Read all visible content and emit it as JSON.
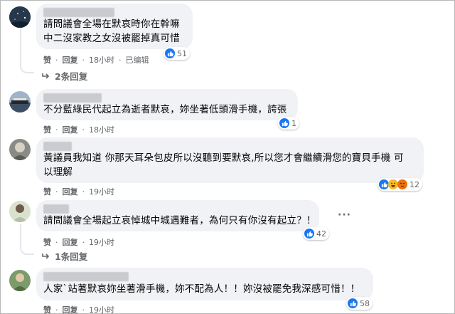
{
  "comments": [
    {
      "lines": [
        "請問議會全場在默哀時你在幹嘛",
        "中二沒家教之女沒被罷掉真可惜"
      ],
      "meta": {
        "like": "赞",
        "reply": "回复",
        "time": "18小时",
        "edited": "已编辑"
      },
      "reactions": {
        "count": "51",
        "icons": [
          "like-icon"
        ]
      },
      "replies_label": "2条回复"
    },
    {
      "lines": [
        "不分藍綠民代起立為逝者默哀，妳坐著低頭滑手機，誇張"
      ],
      "meta": {
        "like": "赞",
        "reply": "回复",
        "time": "18小时"
      },
      "reactions": {
        "count": "1",
        "icons": [
          "like-icon"
        ]
      }
    },
    {
      "lines": [
        "黃議員我知道 你那天耳朵包皮所以沒聽到要默哀,所以您才會繼續滑您的寶貝手機 可",
        "以理解"
      ],
      "meta": {
        "like": "赞",
        "reply": "回复",
        "time": "19小时"
      },
      "reactions": {
        "count": "12",
        "icons": [
          "like-icon",
          "haha-icon",
          "angry-icon"
        ]
      }
    },
    {
      "lines": [
        "請問議會全場起立哀悼城中城遇難者，為何只有你沒有起立？！"
      ],
      "meta": {
        "like": "赞",
        "reply": "回复",
        "time": "19小时"
      },
      "reactions": {
        "count": "42",
        "icons": [
          "like-icon"
        ]
      },
      "replies_label": "1条回复",
      "more": "···"
    },
    {
      "lines": [
        "人家`站著默哀妳坐著滑手機，妳不配為人！！妳沒被罷免我深感可惜！！"
      ],
      "meta": {
        "like": "赞",
        "reply": "回复",
        "time": "19小时"
      },
      "reactions": {
        "count": "58",
        "icons": [
          "like-icon"
        ]
      }
    }
  ],
  "colors": {
    "bubble": "#f0f2f5",
    "like": "#1877f2",
    "meta": "#65676b"
  }
}
